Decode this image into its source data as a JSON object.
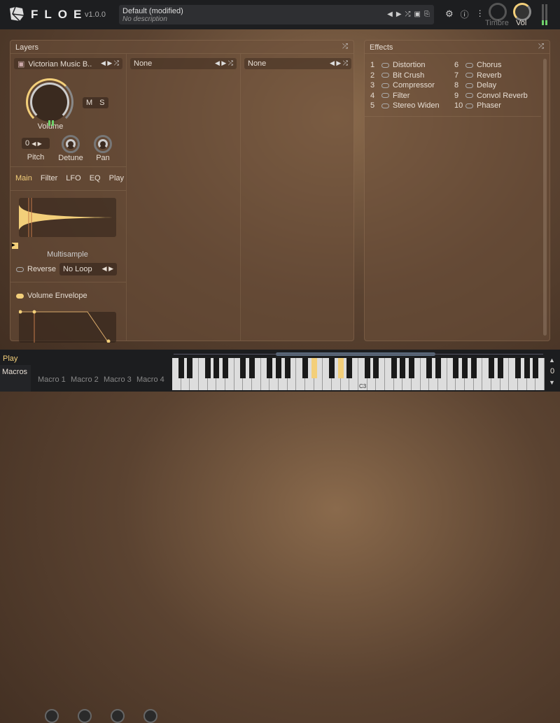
{
  "header": {
    "brand": "FLOE",
    "version": "v1.0.0",
    "preset_name": "Default (modified)",
    "preset_description": "No description",
    "timbre_label": "Timbre",
    "vol_label": "Vol"
  },
  "layers": {
    "title": "Layers",
    "columns": [
      {
        "instrument": "Victorian Music B..",
        "volume_label": "Volume",
        "mute": "M",
        "solo": "S",
        "pitch_value": "0",
        "pitch_label": "Pitch",
        "detune_label": "Detune",
        "pan_label": "Pan",
        "tabs": [
          "Main",
          "Filter",
          "LFO",
          "EQ",
          "Play"
        ],
        "active_tab": "Main",
        "waveform_label": "Multisample",
        "reverse_label": "Reverse",
        "loop_mode": "No Loop",
        "envelope_label": "Volume Envelope",
        "envelope_enabled": true
      },
      {
        "instrument": "None"
      },
      {
        "instrument": "None"
      }
    ]
  },
  "effects": {
    "title": "Effects",
    "items": [
      {
        "n": "1",
        "name": "Distortion"
      },
      {
        "n": "2",
        "name": "Bit Crush"
      },
      {
        "n": "3",
        "name": "Compressor"
      },
      {
        "n": "4",
        "name": "Filter"
      },
      {
        "n": "5",
        "name": "Stereo Widen"
      },
      {
        "n": "6",
        "name": "Chorus"
      },
      {
        "n": "7",
        "name": "Reverb"
      },
      {
        "n": "8",
        "name": "Delay"
      },
      {
        "n": "9",
        "name": "Convol Reverb"
      },
      {
        "n": "10",
        "name": "Phaser"
      }
    ]
  },
  "bottom": {
    "tabs": [
      "Play",
      "Macros"
    ],
    "active_tab": "Play",
    "macros": [
      "Macro 1",
      "Macro 2",
      "Macro 3",
      "Macro 4"
    ],
    "octave": "0",
    "c3_label": "C3",
    "pressed_keys": [
      "D#2",
      "G#2"
    ]
  },
  "colors": {
    "accent": "#f3cf7a",
    "meter": "#6fd06a"
  }
}
